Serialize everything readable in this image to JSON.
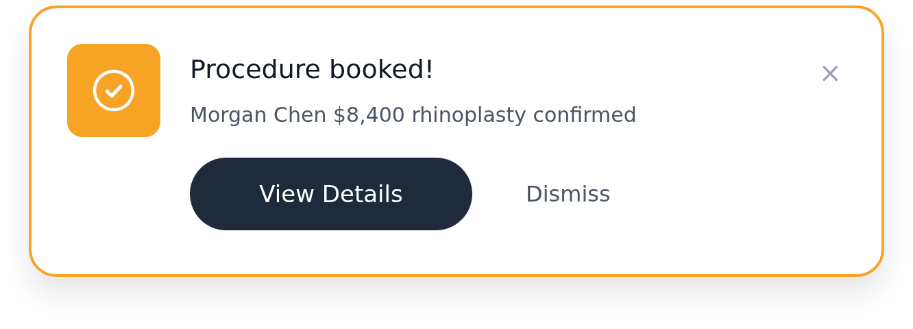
{
  "toast": {
    "title": "Procedure booked!",
    "message": "Morgan Chen $8,400 rhinoplasty confirmed",
    "close": "×",
    "actions": [
      {
        "label": "View Details",
        "kind": "primary"
      },
      {
        "label": "Dismiss",
        "kind": "text"
      }
    ]
  }
}
